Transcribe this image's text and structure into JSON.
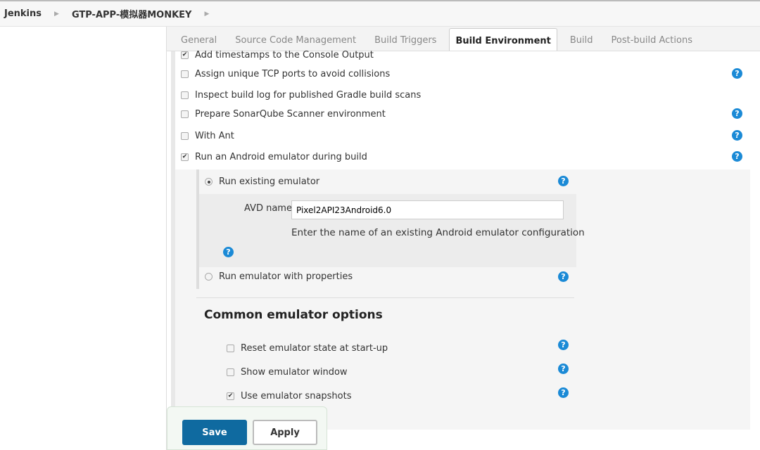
{
  "breadcrumb": {
    "items": [
      "Jenkins",
      "GTP-APP-模拟器MONKEY"
    ]
  },
  "tabs": [
    {
      "label": "General"
    },
    {
      "label": "Source Code Management"
    },
    {
      "label": "Build Triggers"
    },
    {
      "label": "Build Environment",
      "active": true
    },
    {
      "label": "Build"
    },
    {
      "label": "Post-build Actions"
    }
  ],
  "options": [
    {
      "label": "Add timestamps to the Console Output",
      "checked": true
    },
    {
      "label": "Assign unique TCP ports to avoid collisions",
      "checked": false
    },
    {
      "label": "Inspect build log for published Gradle build scans",
      "checked": false
    },
    {
      "label": "Prepare SonarQube Scanner environment",
      "checked": false
    },
    {
      "label": "With Ant",
      "checked": false
    },
    {
      "label": "Run an Android emulator during build",
      "checked": true
    }
  ],
  "emulator": {
    "run_existing": "Run existing emulator",
    "run_existing_selected": true,
    "avd_label": "AVD name",
    "avd_value": "Pixel2API23Android6.0",
    "avd_hint": "Enter the name of an existing Android emulator configuration",
    "run_props": "Run emulator with properties",
    "common_title": "Common emulator options",
    "common": [
      {
        "label": "Reset emulator state at start-up",
        "checked": false
      },
      {
        "label": "Show emulator window",
        "checked": false
      },
      {
        "label": "Use emulator snapshots",
        "checked": true
      }
    ]
  },
  "buttons": {
    "save": "Save",
    "apply": "Apply"
  },
  "colors": {
    "help": "#1b8ad6",
    "save": "#0f6aa0"
  }
}
